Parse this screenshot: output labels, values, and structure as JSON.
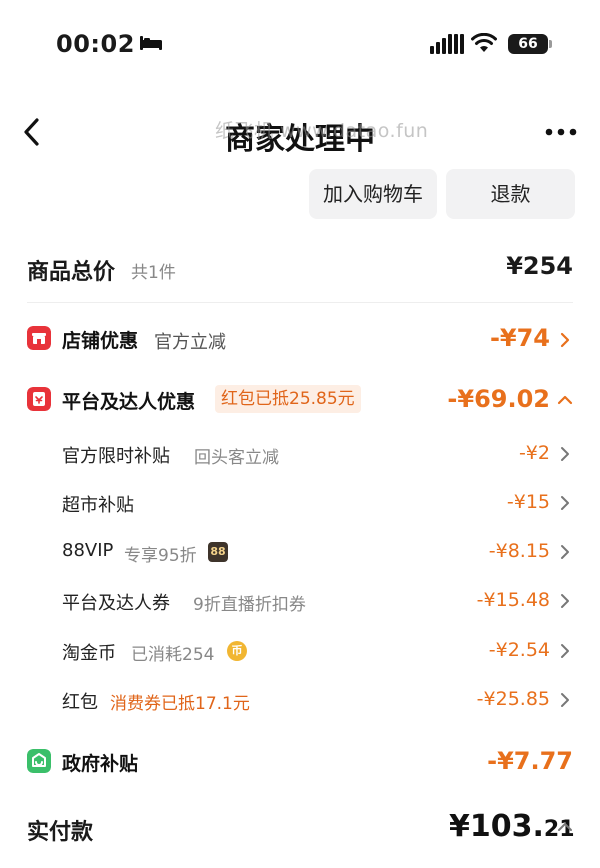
{
  "status_bar": {
    "time": "00:02",
    "battery": "66"
  },
  "nav": {
    "title": "商家处理中",
    "watermark": "纸飞机 www.datao.fun"
  },
  "actions": {
    "add_cart": "加入购物车",
    "refund": "退款"
  },
  "total": {
    "label": "商品总价",
    "count": "共1件",
    "value": "¥254"
  },
  "store_discount": {
    "label": "店铺优惠",
    "sub": "官方立减",
    "value": "-¥74"
  },
  "platform_discount": {
    "label": "平台及达人优惠",
    "tag": "红包已抵25.85元",
    "value": "-¥69.02",
    "items": [
      {
        "label": "官方限时补贴",
        "note": "回头客立减",
        "value": "-¥2"
      },
      {
        "label": "超市补贴",
        "note": "",
        "value": "-¥15"
      },
      {
        "label": "88VIP",
        "note": "专享95折",
        "badge": "88",
        "value": "-¥8.15"
      },
      {
        "label": "平台及达人券",
        "note": "9折直播折扣券",
        "value": "-¥15.48"
      },
      {
        "label": "淘金币",
        "note": "已消耗254",
        "badge": "币",
        "value": "-¥2.54"
      },
      {
        "label": "红包",
        "note": "消费券已抵17.1元",
        "value": "-¥25.85"
      }
    ]
  },
  "gov_subsidy": {
    "label": "政府补贴",
    "value": "-¥7.77"
  },
  "paid": {
    "label": "实付款",
    "value_main": "¥103.",
    "value_cents": "21"
  },
  "colors": {
    "accent": "#e8701c",
    "red_icon": "#e8333a",
    "green_icon": "#3bbf6a"
  }
}
